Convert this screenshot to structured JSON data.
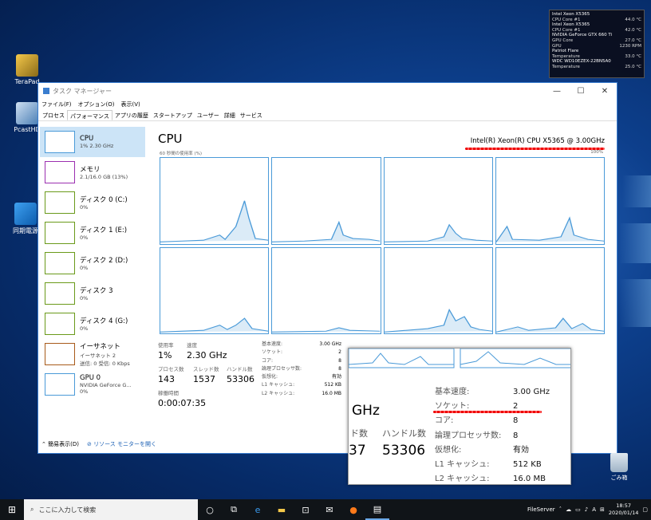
{
  "colors": {
    "accent": "#3a7dcf",
    "selection": "#cce4f7",
    "cpu_graph": "#4a9ad8",
    "memory": "#9b2fb0",
    "disk": "#6a9a1a",
    "ethernet": "#a85a1a"
  },
  "desktop": {
    "icons": [
      {
        "label": "TeraPad",
        "icon": "terapad-icon"
      },
      {
        "label": "PcastHD",
        "icon": "pcasthd-icon"
      },
      {
        "label": "同期電源",
        "icon": "sync-app-icon"
      }
    ],
    "recycle_bin": "ごみ箱"
  },
  "hw_monitor": {
    "devices": [
      {
        "name": "Intel Xeon X5365",
        "rows": [
          {
            "label": "CPU Core #1",
            "value": "44.0 °C"
          }
        ]
      },
      {
        "name": "Intel Xeon X5365",
        "rows": [
          {
            "label": "CPU Core #1",
            "value": "42.0 °C"
          }
        ]
      },
      {
        "name": "NVIDIA GeForce GTX 660 Ti",
        "rows": [
          {
            "label": "GPU Core",
            "value": "27.0 °C"
          },
          {
            "label": "GPU",
            "value": "1230 RPM"
          }
        ]
      },
      {
        "name": "Patriot Flare",
        "rows": [
          {
            "label": "Temperature",
            "value": "33.0 °C"
          }
        ]
      },
      {
        "name": "WDC WD10EZEX-22BN5A0",
        "rows": [
          {
            "label": "Temperature",
            "value": "25.0 °C"
          }
        ]
      }
    ]
  },
  "taskmgr": {
    "title": "タスク マネージャー",
    "window_controls": {
      "minimize": "—",
      "maximize": "☐",
      "close": "✕"
    },
    "menu": [
      "ファイル(F)",
      "オプション(O)",
      "表示(V)"
    ],
    "tabs": [
      "プロセス",
      "パフォーマンス",
      "アプリの履歴",
      "スタートアップ",
      "ユーザー",
      "詳細",
      "サービス"
    ],
    "active_tab": 1,
    "sidebar": [
      {
        "title": "CPU",
        "detail": "1% 2.30 GHz",
        "selected": true,
        "color": "#4a9ad8"
      },
      {
        "title": "メモリ",
        "detail": "2.1/16.0 GB (13%)",
        "color": "#9b2fb0"
      },
      {
        "title": "ディスク 0 (C:)",
        "detail": "0%",
        "color": "#6a9a1a"
      },
      {
        "title": "ディスク 1 (E:)",
        "detail": "0%",
        "color": "#6a9a1a"
      },
      {
        "title": "ディスク 2 (D:)",
        "detail": "0%",
        "color": "#6a9a1a"
      },
      {
        "title": "ディスク 3",
        "detail": "0%",
        "color": "#6a9a1a"
      },
      {
        "title": "ディスク 4 (G:)",
        "detail": "0%",
        "color": "#6a9a1a"
      },
      {
        "title": "イーサネット",
        "detail": "イーサネット 2",
        "detail2": "送信: 0 受信: 0 Kbps",
        "color": "#a85a1a"
      },
      {
        "title": "GPU 0",
        "detail": "NVIDIA GeForce G...",
        "detail2": "0%",
        "color": "#4a9ad8"
      }
    ],
    "main": {
      "title": "CPU",
      "model": "Intel(R) Xeon(R) CPU X5365 @ 3.00GHz",
      "util_label": "60 秒間の使用率 (%)",
      "util_max": "100%",
      "stats": {
        "usage_label": "使用率",
        "usage": "1%",
        "speed_label": "速度",
        "speed": "2.30 GHz",
        "processes_label": "プロセス数",
        "processes": "143",
        "threads_label": "スレッド数",
        "threads": "1537",
        "handles_label": "ハンドル数",
        "handles": "53306",
        "uptime_label": "稼働時間",
        "uptime": "0:00:07:35"
      },
      "specs": [
        {
          "label": "基本速度:",
          "value": "3.00 GHz"
        },
        {
          "label": "ソケット:",
          "value": "2"
        },
        {
          "label": "コア:",
          "value": "8"
        },
        {
          "label": "論理プロセッサ数:",
          "value": "8"
        },
        {
          "label": "仮想化:",
          "value": "有効"
        },
        {
          "label": "L1 キャッシュ:",
          "value": "512 KB"
        },
        {
          "label": "L2 キャッシュ:",
          "value": "16.0 MB"
        }
      ]
    },
    "footer": {
      "less_details": "簡易表示(D)",
      "resource_monitor": "リソース モニターを開く"
    }
  },
  "zoom": {
    "speed_partial": "GHz",
    "threads_partial_label": "ド数",
    "handles_label": "ハンドル数",
    "threads_partial": "37",
    "handles": "53306"
  },
  "taskbar": {
    "search_placeholder": "ここに入力して検索",
    "tray_label": "FileServer",
    "ime": "A",
    "time": "18:57",
    "date": "2020/01/14"
  }
}
